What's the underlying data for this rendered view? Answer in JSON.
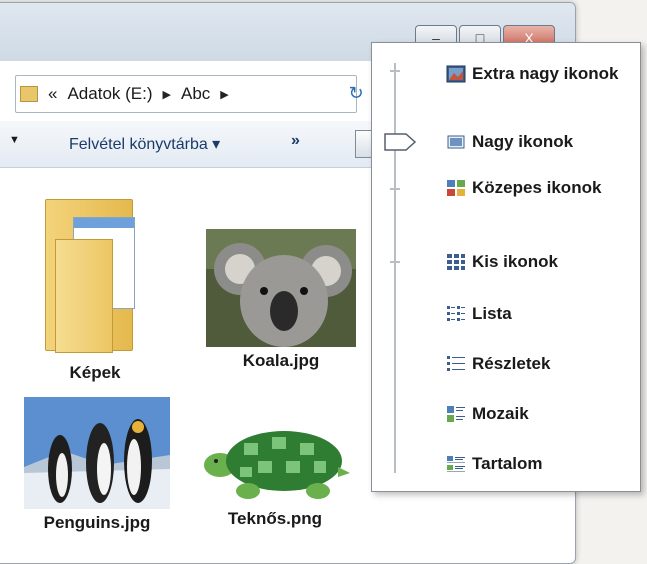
{
  "address": {
    "back_glyph": "«",
    "segments": [
      "Adatok (E:)",
      "Abc"
    ]
  },
  "window": {
    "minimize_glyph": "–",
    "maximize_glyph": "□",
    "close_glyph": "X"
  },
  "toolbar": {
    "library_label": "Felvétel könyvtárba ▾",
    "more_label": "»"
  },
  "files": [
    {
      "name": "Képek",
      "icon": "folder-icon"
    },
    {
      "name": "Koala.jpg",
      "icon": "image-thumbnail"
    },
    {
      "name": "Penguins.jpg",
      "icon": "image-thumbnail"
    },
    {
      "name": "Teknős.png",
      "icon": "image-thumbnail"
    }
  ],
  "view_menu": {
    "selected": "Nagy ikonok",
    "items": [
      {
        "label": "Extra nagy ikonok",
        "icon": "extra-large-icons-icon"
      },
      {
        "label": "Nagy ikonok",
        "icon": "large-icons-icon"
      },
      {
        "label": "Közepes ikonok",
        "icon": "medium-icons-icon"
      },
      {
        "label": "Kis ikonok",
        "icon": "small-icons-icon"
      },
      {
        "label": "Lista",
        "icon": "list-icon"
      },
      {
        "label": "Részletek",
        "icon": "details-icon"
      },
      {
        "label": "Mozaik",
        "icon": "tiles-icon"
      },
      {
        "label": "Tartalom",
        "icon": "content-icon"
      }
    ]
  },
  "colors": {
    "accent": "#2d6cb5",
    "folder": "#e9c66c",
    "menu_border": "#8a8f96"
  }
}
